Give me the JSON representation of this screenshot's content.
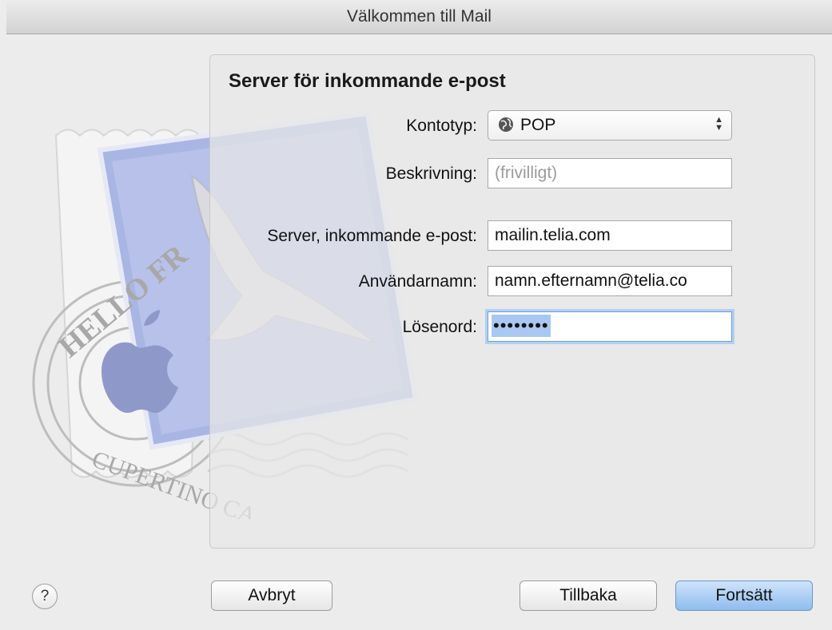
{
  "window": {
    "title": "Välkommen till Mail"
  },
  "stamp": {
    "top_text": "HELLO FR",
    "bottom_text": "CUPERTINO CA"
  },
  "form": {
    "section_title": "Server för inkommande e-post",
    "account_type": {
      "label": "Kontotyp:",
      "value": "POP",
      "icon": "globe-icon"
    },
    "description": {
      "label": "Beskrivning:",
      "value": "",
      "placeholder": "(frivilligt)"
    },
    "incoming_server": {
      "label": "Server, inkommande e-post:",
      "value": "mailin.telia.com"
    },
    "username": {
      "label": "Användarnamn:",
      "value": "namn.efternamn@telia.co"
    },
    "password": {
      "label": "Lösenord:",
      "value": "••••••••"
    }
  },
  "buttons": {
    "help": "?",
    "cancel": "Avbryt",
    "back": "Tillbaka",
    "continue": "Fortsätt"
  },
  "colors": {
    "focus_ring": "#b2cff3",
    "primary_button": "#8fbcee",
    "stamp_paper": "#a9b6e4"
  }
}
